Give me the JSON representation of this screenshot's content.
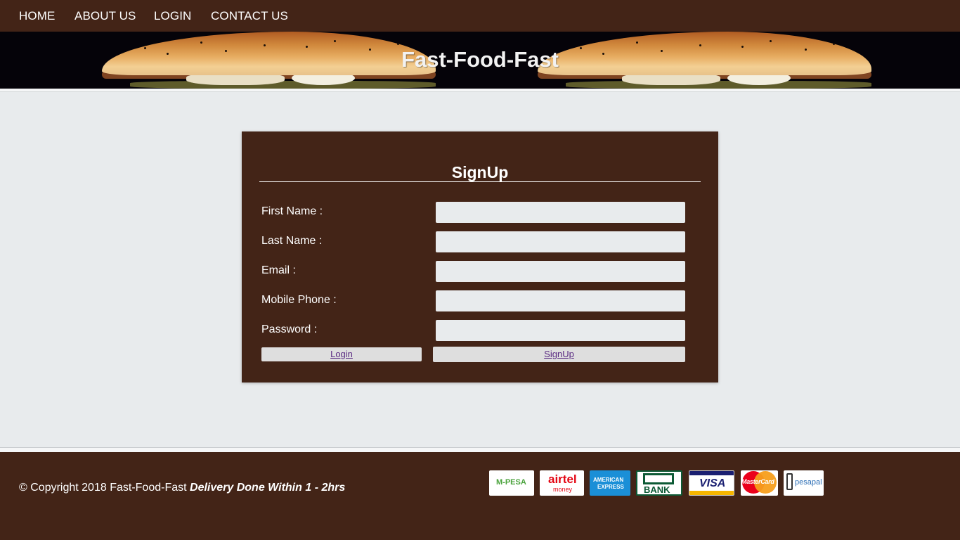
{
  "nav": {
    "home": "HOME",
    "about": "ABOUT US",
    "login": "LOGIN",
    "contact": "CONTACT US"
  },
  "hero": {
    "title": "Fast-Food-Fast"
  },
  "form": {
    "title": "SignUp",
    "fields": [
      {
        "label": "First Name :",
        "value": ""
      },
      {
        "label": "Last Name :",
        "value": ""
      },
      {
        "label": "Email :",
        "value": ""
      },
      {
        "label": "Mobile Phone :",
        "value": ""
      },
      {
        "label": "Password :",
        "value": ""
      }
    ],
    "login_button": "Login",
    "signup_button": "SignUp"
  },
  "footer": {
    "copyright": "© Copyright 2018 Fast-Food-Fast",
    "tagline": "Delivery Done Within 1 - 2hrs",
    "payments": [
      {
        "name": "mpesa-logo",
        "text": "M-PESA"
      },
      {
        "name": "airtel-money-logo",
        "text": "airtel",
        "sub": "money"
      },
      {
        "name": "american-express-logo",
        "text": "AMERICAN",
        "sub": "EXPRESS"
      },
      {
        "name": "co-op-bank-logo",
        "text": "BANK"
      },
      {
        "name": "visa-logo",
        "text": "VISA"
      },
      {
        "name": "mastercard-logo",
        "text": "MasterCard"
      },
      {
        "name": "pesapal-logo",
        "text": "pesapal"
      }
    ]
  },
  "colors": {
    "brand_brown": "#432417",
    "page_bg": "#e8ebed",
    "hero_bg": "#050309"
  }
}
